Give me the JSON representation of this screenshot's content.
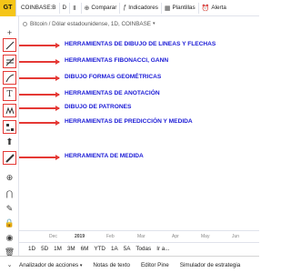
{
  "app": {
    "logo": "GT"
  },
  "topbar": {
    "symbol": "COINBASE:B",
    "interval": "D",
    "compare_label": "Comparar",
    "indicators_label": "Indicadores",
    "templates_label": "Plantillas",
    "alert_label": "Alerta"
  },
  "chart": {
    "title": "Bitcoin / Dólar estadounidense, 1D, COINBASE"
  },
  "annotations": [
    {
      "text": "HERRAMIENTAS DE DIBUJO DE LINEAS Y FLECHAS"
    },
    {
      "text": "HERRAMIENTAS FIBONACCI, GANN"
    },
    {
      "text": "DIBUJO FORMAS GEOMÉTRICAS"
    },
    {
      "text": "HERRAMIENTAS DE ANOTACIÓN"
    },
    {
      "text": "DIBUJO DE PATRONES"
    },
    {
      "text": "HERRAMIENTAS DE PREDICCIÓN Y MEDIDA"
    },
    {
      "text": "HERRAMIENTA DE MEDIDA"
    }
  ],
  "xaxis": {
    "labels": [
      "Dec",
      "2019",
      "Feb",
      "Mar",
      "Apr",
      "May",
      "Jun"
    ]
  },
  "periods": [
    "1D",
    "5D",
    "1M",
    "3M",
    "6M",
    "YTD",
    "1A",
    "5A",
    "Todas",
    "Ir a..."
  ],
  "bottom_tabs": {
    "screener": "Analizador de acciones",
    "notes": "Notas de texto",
    "pine": "Editor Pine",
    "strategy": "Simulador de estrategia"
  },
  "colors": {
    "accent_red": "#e53935",
    "label_blue": "#1a1ad6",
    "logo_yellow": "#f5c518"
  }
}
